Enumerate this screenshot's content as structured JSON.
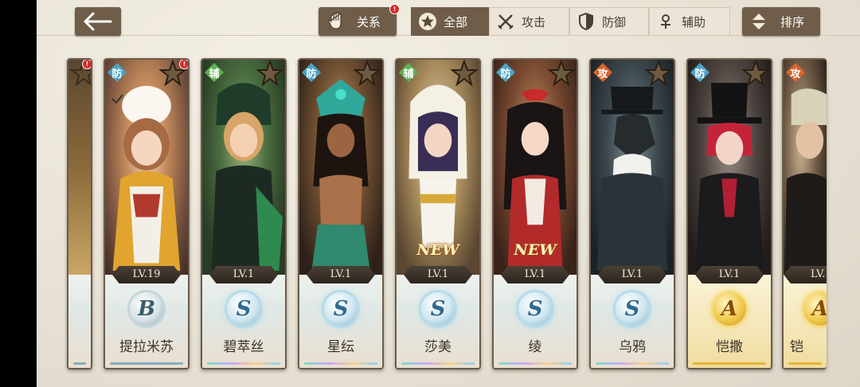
{
  "header": {
    "relation_label": "关系",
    "sort_label": "排序",
    "filters": [
      {
        "label": "全部",
        "icon": "star-circle-icon",
        "active": true
      },
      {
        "label": "攻击",
        "icon": "crossed-swords-icon",
        "active": false
      },
      {
        "label": "防御",
        "icon": "shield-icon",
        "active": false
      },
      {
        "label": "辅助",
        "icon": "support-icon",
        "active": false
      }
    ]
  },
  "cards": [
    {
      "name": "",
      "level": "",
      "rank": "",
      "role": "",
      "partial": "left"
    },
    {
      "name": "提拉米苏",
      "level": "LV.19",
      "rank": "B",
      "role": "防",
      "new": ""
    },
    {
      "name": "碧萃丝",
      "level": "LV.1",
      "rank": "S",
      "role": "辅",
      "new": ""
    },
    {
      "name": "星纭",
      "level": "LV.1",
      "rank": "S",
      "role": "防",
      "new": ""
    },
    {
      "name": "莎美",
      "level": "LV.1",
      "rank": "S",
      "role": "辅",
      "new": "NEW"
    },
    {
      "name": "绫",
      "level": "LV.1",
      "rank": "S",
      "role": "防",
      "new": "NEW"
    },
    {
      "name": "乌鸦",
      "level": "LV.1",
      "rank": "S",
      "role": "",
      "new": ""
    },
    {
      "name": "恺撒",
      "level": "LV.1",
      "rank": "A",
      "role": "防",
      "new": ""
    },
    {
      "name": "铠",
      "level": "LV.",
      "rank": "A",
      "role": "攻",
      "new": ""
    }
  ],
  "crow_role": "攻",
  "colors": {
    "button_brown": "#6f5d49",
    "background": "#ebe5d8",
    "defense_blue": "#4aa3c5",
    "support_green": "#5db150",
    "attack_orange": "#d9642f"
  }
}
